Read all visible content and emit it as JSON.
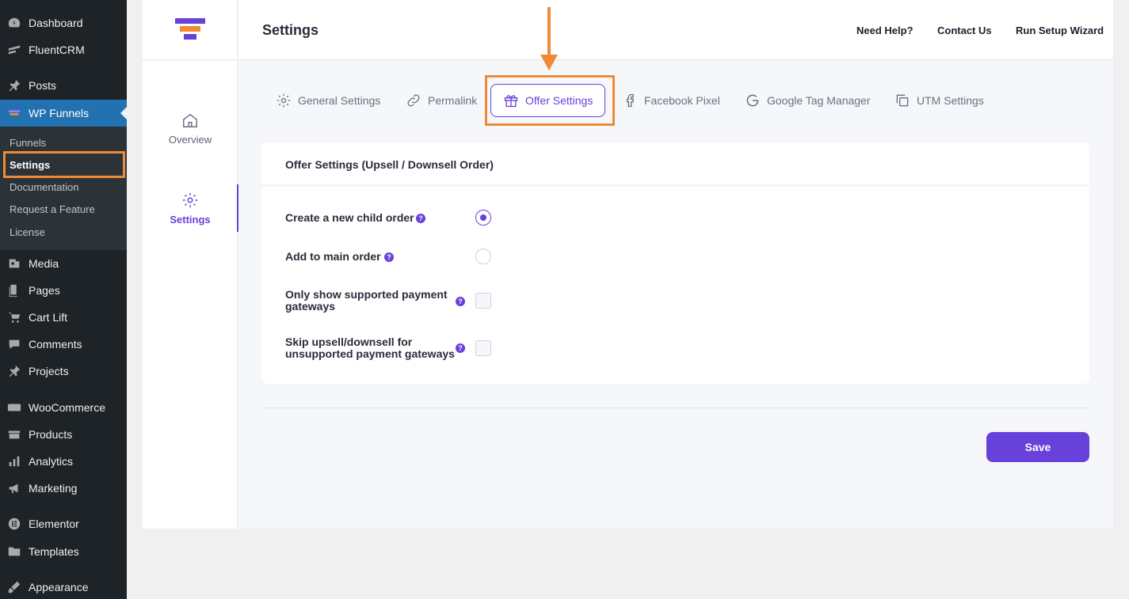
{
  "wp_menu": {
    "items": [
      {
        "label": "Dashboard",
        "icon": "dashboard-icon"
      },
      {
        "label": "FluentCRM",
        "icon": "fluentcrm-icon"
      },
      {
        "label": "Posts",
        "icon": "pin-icon"
      },
      {
        "label": "WP Funnels",
        "icon": "funnel-icon"
      },
      {
        "label": "Media",
        "icon": "media-icon"
      },
      {
        "label": "Pages",
        "icon": "pages-icon"
      },
      {
        "label": "Cart Lift",
        "icon": "cart-icon"
      },
      {
        "label": "Comments",
        "icon": "comment-icon"
      },
      {
        "label": "Projects",
        "icon": "pin-icon"
      },
      {
        "label": "WooCommerce",
        "icon": "woo-icon"
      },
      {
        "label": "Products",
        "icon": "products-icon"
      },
      {
        "label": "Analytics",
        "icon": "analytics-icon"
      },
      {
        "label": "Marketing",
        "icon": "megaphone-icon"
      },
      {
        "label": "Elementor",
        "icon": "elementor-icon"
      },
      {
        "label": "Templates",
        "icon": "folder-icon"
      },
      {
        "label": "Appearance",
        "icon": "brush-icon"
      }
    ],
    "submenu": [
      "Funnels",
      "Settings",
      "Documentation",
      "Request a Feature",
      "License"
    ]
  },
  "header": {
    "title": "Settings",
    "links": [
      "Need Help?",
      "Contact Us",
      "Run Setup Wizard"
    ]
  },
  "left_nav": [
    {
      "label": "Overview",
      "icon": "home-icon"
    },
    {
      "label": "Settings",
      "icon": "gear-icon"
    }
  ],
  "tabs": [
    {
      "label": "General Settings",
      "icon": "gear-icon"
    },
    {
      "label": "Permalink",
      "icon": "link-icon"
    },
    {
      "label": "Offer Settings",
      "icon": "gift-icon"
    },
    {
      "label": "Facebook Pixel",
      "icon": "facebook-icon"
    },
    {
      "label": "Google Tag Manager",
      "icon": "google-icon"
    },
    {
      "label": "UTM Settings",
      "icon": "copy-icon"
    }
  ],
  "offer_card": {
    "title": "Offer Settings (Upsell / Downsell Order)",
    "options": [
      {
        "label": "Create a new child order",
        "type": "radio",
        "checked": true
      },
      {
        "label": "Add to main order",
        "type": "radio",
        "checked": false
      },
      {
        "label_line1": "Only show supported payment",
        "label_line2": "gateways",
        "type": "checkbox",
        "checked": false
      },
      {
        "label_line1": "Skip upsell/downsell for",
        "label_line2": "unsupported payment gateways",
        "type": "checkbox",
        "checked": false
      }
    ]
  },
  "help_glyph": "?",
  "save_label": "Save",
  "colors": {
    "accent": "#6741d9",
    "highlight": "#f08a35",
    "wp_active": "#2271b1",
    "wp_sidebar": "#1d2327"
  }
}
